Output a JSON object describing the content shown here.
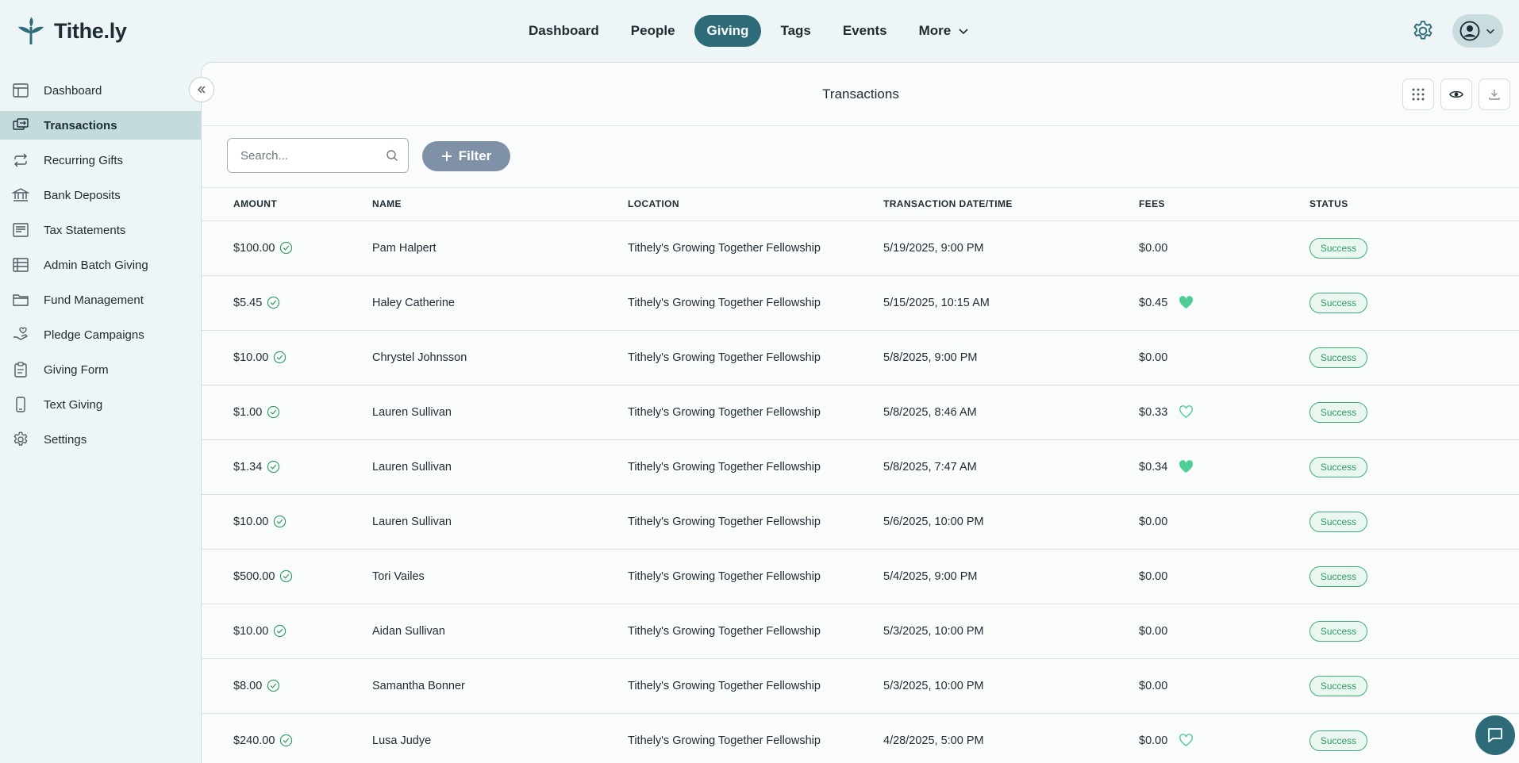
{
  "brand": {
    "name": "Tithe.ly"
  },
  "topnav": {
    "items": [
      {
        "label": "Dashboard",
        "active": false
      },
      {
        "label": "People",
        "active": false
      },
      {
        "label": "Giving",
        "active": true
      },
      {
        "label": "Tags",
        "active": false
      },
      {
        "label": "Events",
        "active": false
      },
      {
        "label": "More",
        "active": false
      }
    ]
  },
  "sidebar": {
    "items": [
      {
        "label": "Dashboard",
        "icon": "layout-icon"
      },
      {
        "label": "Transactions",
        "icon": "transfer-icon",
        "active": true
      },
      {
        "label": "Recurring Gifts",
        "icon": "repeat-icon"
      },
      {
        "label": "Bank Deposits",
        "icon": "bank-icon"
      },
      {
        "label": "Tax Statements",
        "icon": "receipt-icon"
      },
      {
        "label": "Admin Batch Giving",
        "icon": "list-icon"
      },
      {
        "label": "Fund Management",
        "icon": "folder-icon"
      },
      {
        "label": "Pledge Campaigns",
        "icon": "hand-heart-icon"
      },
      {
        "label": "Giving Form",
        "icon": "clipboard-icon"
      },
      {
        "label": "Text Giving",
        "icon": "phone-icon"
      },
      {
        "label": "Settings",
        "icon": "gear-icon"
      }
    ]
  },
  "main": {
    "title": "Transactions",
    "search_placeholder": "Search...",
    "filter_label": "Filter"
  },
  "table": {
    "columns": [
      "AMOUNT",
      "NAME",
      "LOCATION",
      "TRANSACTION DATE/TIME",
      "FEES",
      "STATUS"
    ],
    "rows": [
      {
        "amount": "$100.00",
        "name": "Pam Halpert",
        "location": "Tithely's Growing Together Fellowship",
        "datetime": "5/19/2025, 9:00 PM",
        "fees": "$0.00",
        "fee_heart": "none",
        "status": "Success"
      },
      {
        "amount": "$5.45",
        "name": "Haley Catherine",
        "location": "Tithely's Growing Together Fellowship",
        "datetime": "5/15/2025, 10:15 AM",
        "fees": "$0.45",
        "fee_heart": "filled",
        "status": "Success"
      },
      {
        "amount": "$10.00",
        "name": "Chrystel Johnsson",
        "location": "Tithely's Growing Together Fellowship",
        "datetime": "5/8/2025, 9:00 PM",
        "fees": "$0.00",
        "fee_heart": "none",
        "status": "Success"
      },
      {
        "amount": "$1.00",
        "name": "Lauren Sullivan",
        "location": "Tithely's Growing Together Fellowship",
        "datetime": "5/8/2025, 8:46 AM",
        "fees": "$0.33",
        "fee_heart": "outline",
        "status": "Success"
      },
      {
        "amount": "$1.34",
        "name": "Lauren Sullivan",
        "location": "Tithely's Growing Together Fellowship",
        "datetime": "5/8/2025, 7:47 AM",
        "fees": "$0.34",
        "fee_heart": "filled",
        "status": "Success"
      },
      {
        "amount": "$10.00",
        "name": "Lauren Sullivan",
        "location": "Tithely's Growing Together Fellowship",
        "datetime": "5/6/2025, 10:00 PM",
        "fees": "$0.00",
        "fee_heart": "none",
        "status": "Success"
      },
      {
        "amount": "$500.00",
        "name": "Tori Vailes",
        "location": "Tithely's Growing Together Fellowship",
        "datetime": "5/4/2025, 9:00 PM",
        "fees": "$0.00",
        "fee_heart": "none",
        "status": "Success"
      },
      {
        "amount": "$10.00",
        "name": "Aidan Sullivan",
        "location": "Tithely's Growing Together Fellowship",
        "datetime": "5/3/2025, 10:00 PM",
        "fees": "$0.00",
        "fee_heart": "none",
        "status": "Success"
      },
      {
        "amount": "$8.00",
        "name": "Samantha Bonner",
        "location": "Tithely's Growing Together Fellowship",
        "datetime": "5/3/2025, 10:00 PM",
        "fees": "$0.00",
        "fee_heart": "none",
        "status": "Success"
      },
      {
        "amount": "$240.00",
        "name": "Lusa Judye",
        "location": "Tithely's Growing Together Fellowship",
        "datetime": "4/28/2025, 5:00 PM",
        "fees": "$0.00",
        "fee_heart": "outline",
        "status": "Success"
      }
    ]
  },
  "colors": {
    "brand": "#2e6b78",
    "success": "#2e9a62",
    "heart": "#4fcf95"
  }
}
